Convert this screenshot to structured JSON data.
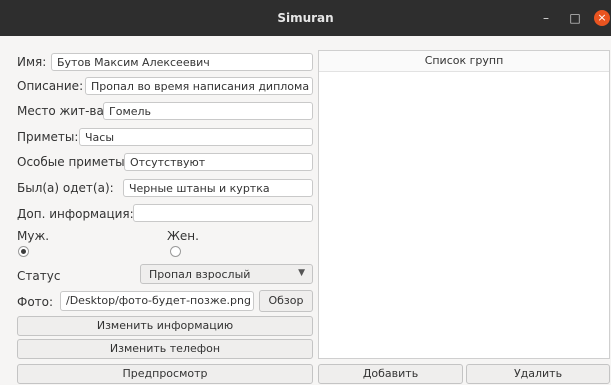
{
  "window": {
    "title": "Simuran",
    "minimize": "–",
    "maximize": "□",
    "close": "×"
  },
  "form": {
    "name_label": "Имя:",
    "name_value": "Бутов Максим Алексеевич",
    "desc_label": "Описание:",
    "desc_value": "Пропал во время написания диплома",
    "residence_label": "Место жит-ва:",
    "residence_value": "Гомель",
    "signs_label": "Приметы:",
    "signs_value": "Часы",
    "special_label": "Особые приметы:",
    "special_value": "Отсутствуют",
    "clothes_label": "Был(а) одет(а):",
    "clothes_value": "Черные штаны и куртка",
    "extra_label": "Доп. информация:",
    "extra_value": "",
    "male_label": "Муж.",
    "female_label": "Жен.",
    "status_label": "Статус",
    "status_value": "Пропал взрослый",
    "photo_label": "Фото:",
    "photo_value": "/Desktop/фото-будет-позже.png",
    "browse_button": "Обзор",
    "edit_info_button": "Изменить информацию",
    "edit_phone_button": "Изменить телефон",
    "preview_button": "Предпросмотр"
  },
  "groups": {
    "header": "Список групп",
    "add_button": "Добавить",
    "delete_button": "Удалить"
  },
  "icons": {
    "status_dropdown": "chevron-down-icon"
  }
}
